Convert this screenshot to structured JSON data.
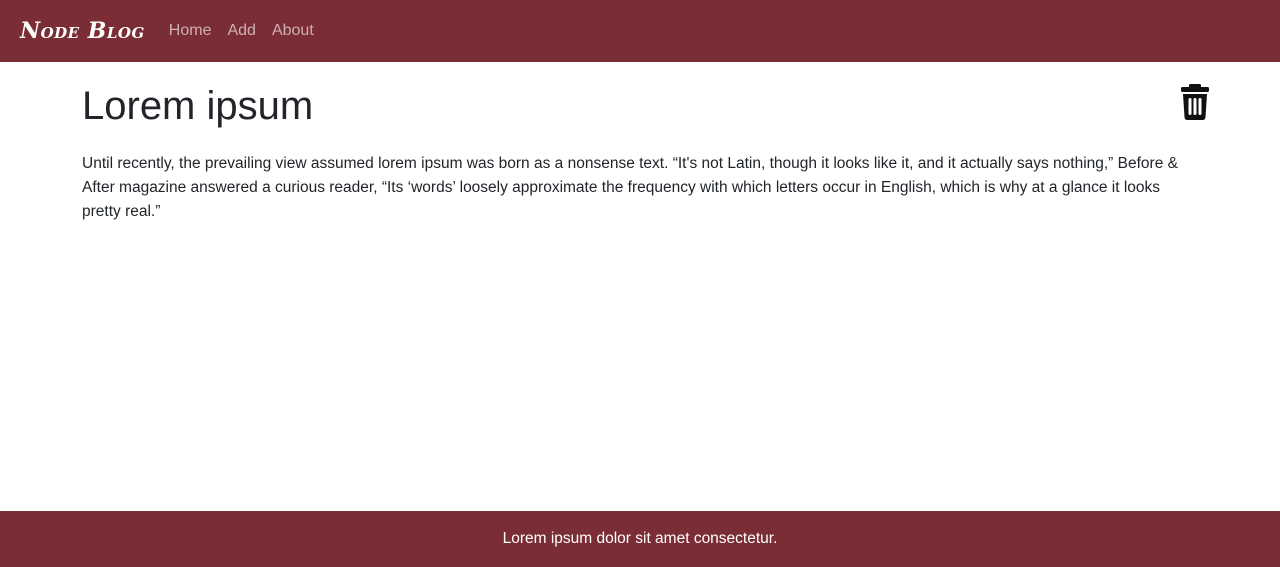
{
  "navbar": {
    "brand": "Node Blog",
    "links": [
      {
        "label": "Home"
      },
      {
        "label": "Add"
      },
      {
        "label": "About"
      }
    ],
    "background": "#7a2d34"
  },
  "post": {
    "title": "Lorem ipsum",
    "body": "Until recently, the prevailing view assumed lorem ipsum was born as a nonsense text. “It's not Latin, though it looks like it, and it actually says nothing,” Before & After magazine answered a curious reader, “Its ‘words’ loosely approximate the frequency with which letters occur in English, which is why at a glance it looks pretty real.”",
    "delete_icon": "trash-icon"
  },
  "footer": {
    "text": "Lorem ipsum dolor sit amet consectetur."
  }
}
